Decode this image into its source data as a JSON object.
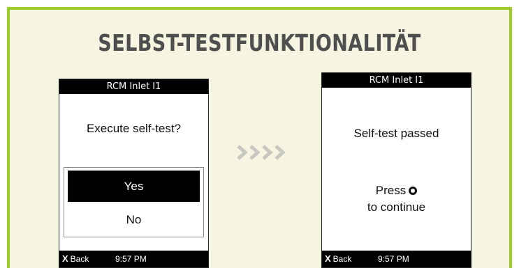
{
  "title": "SELBST-TESTFUNKTIONALITÄT",
  "colors": {
    "frame_border": "#9ccb2a",
    "frame_background": "#f6f5e1",
    "title_text": "#4f4f4f",
    "arrow": "#c8c8c0"
  },
  "left_screen": {
    "header": "RCM Inlet I1",
    "question": "Execute self-test?",
    "options": [
      {
        "label": "Yes",
        "selected": true
      },
      {
        "label": "No",
        "selected": false
      }
    ],
    "footer": {
      "back_icon": "X",
      "back_label": "Back",
      "time": "9:57 PM"
    }
  },
  "arrow_icon": "chevrons-right-icon",
  "right_screen": {
    "header": "RCM Inlet I1",
    "message": "Self-test passed",
    "press_line": "Press",
    "ok_icon": "circle-ok-icon",
    "continue_line": "to continue",
    "footer": {
      "back_icon": "X",
      "back_label": "Back",
      "time": "9:57 PM"
    }
  }
}
